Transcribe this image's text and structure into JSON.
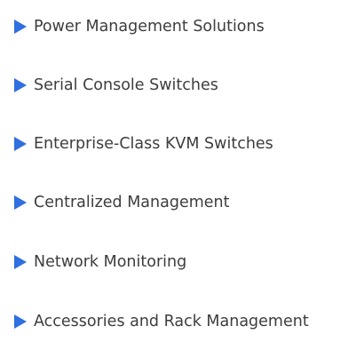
{
  "accent_color": "#2f6fe0",
  "text_color": "#3d3d3d",
  "menu": {
    "items": [
      {
        "label": "Power Management Solutions",
        "icon": "triangle-right-icon"
      },
      {
        "label": "Serial Console Switches",
        "icon": "triangle-right-icon"
      },
      {
        "label": "Enterprise-Class KVM Switches",
        "icon": "triangle-right-icon"
      },
      {
        "label": "Centralized Management",
        "icon": "triangle-right-icon"
      },
      {
        "label": "Network Monitoring",
        "icon": "triangle-right-icon"
      },
      {
        "label": "Accessories and Rack Management",
        "icon": "triangle-right-icon"
      }
    ]
  }
}
